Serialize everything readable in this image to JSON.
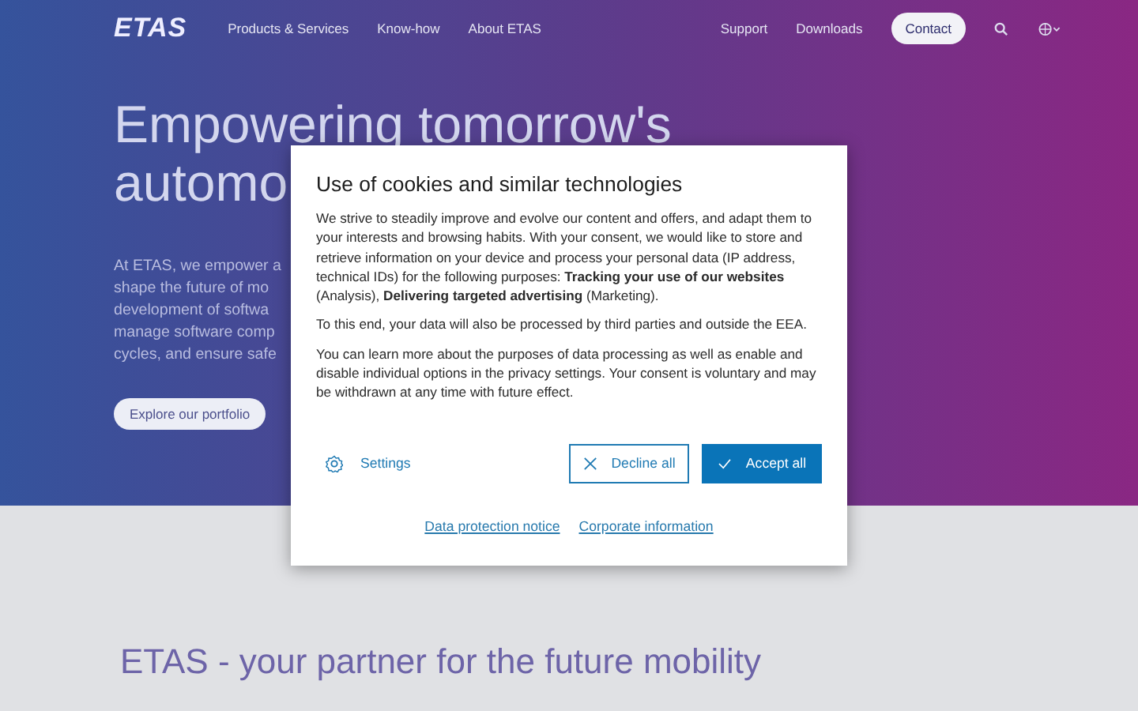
{
  "header": {
    "logo": "ETAS",
    "nav": [
      "Products & Services",
      "Know-how",
      "About ETAS"
    ],
    "utility": [
      "Support",
      "Downloads"
    ],
    "contact": "Contact"
  },
  "hero": {
    "heading_lines": [
      "Empowering tomorrow's",
      "automo"
    ],
    "paragraph_lines": [
      "At ETAS, we empower a",
      "shape the future of mo",
      "development of softwa",
      "manage software comp",
      "cycles, and ensure safe"
    ],
    "button": "Explore our portfolio"
  },
  "section": {
    "heading": "ETAS - your partner for the future mobility"
  },
  "cookie_dialog": {
    "title": "Use of cookies and similar technologies",
    "paragraphs": [
      "We strive to steadily improve and evolve our content and offers, and adapt them to your interests and browsing habits. With your consent, we would like to store and retrieve information on your device and process your personal data (IP address, technical IDs) for the following purposes: **Tracking your use of our websites** (Analysis), **Delivering targeted advertising** (Marketing).",
      "To this end, your data will also be processed by third parties and outside the EEA.",
      "You can learn more about the purposes of data processing as well as enable and disable individual options in the privacy settings. Your consent is voluntary and may be withdrawn at any time with future effect."
    ],
    "settings": "Settings",
    "decline": "Decline all",
    "accept": "Accept all",
    "links": [
      "Data protection notice",
      "Corporate information"
    ]
  }
}
